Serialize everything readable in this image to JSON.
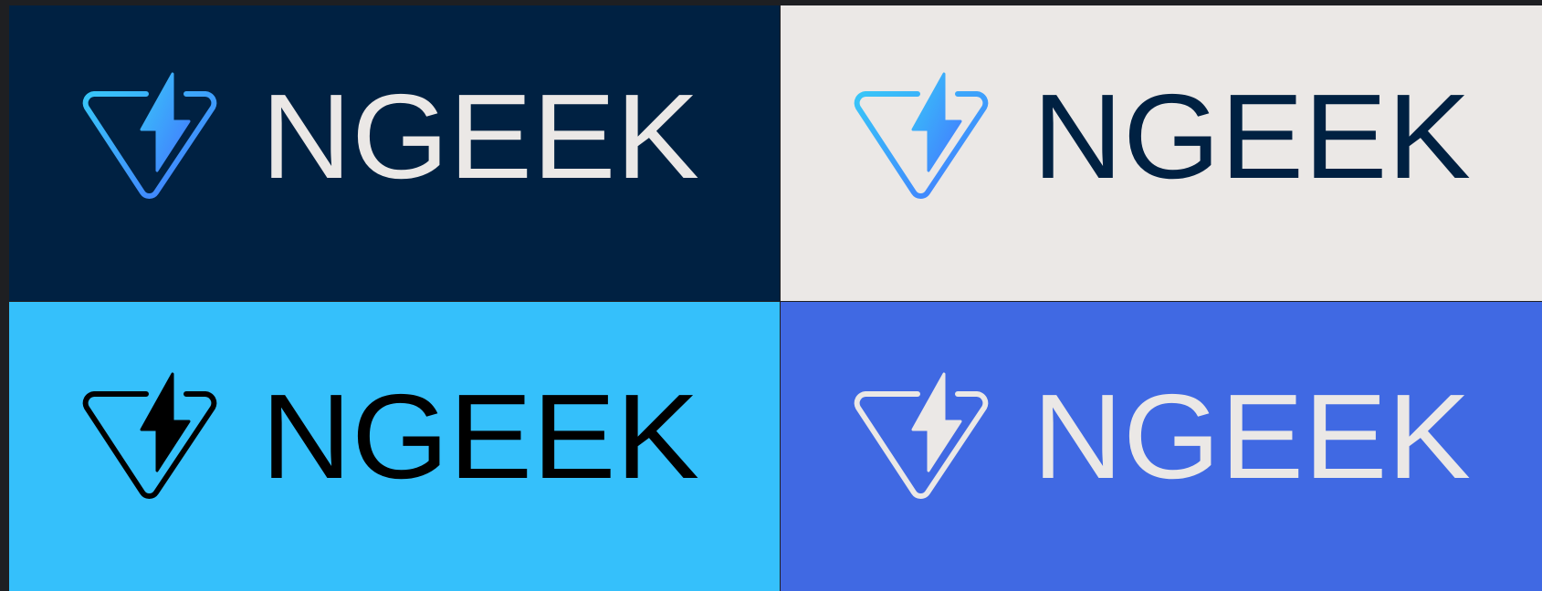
{
  "brand": {
    "wordmark": "NGEEK",
    "icon": "lightning-triangle-icon"
  },
  "colors": {
    "navy": "#002142",
    "light_gray": "#ebe8e6",
    "sky_blue": "#35c0fb",
    "royal_blue": "#4069e3",
    "gradient_start": "#38c6f8",
    "gradient_end": "#4377ff",
    "black": "#000000",
    "off_white": "#ebe8e6"
  },
  "panels": [
    {
      "variant": "gradient-on-navy",
      "wordmark": "NGEEK"
    },
    {
      "variant": "gradient-on-light-gray",
      "wordmark": "NGEEK"
    },
    {
      "variant": "black-on-sky-blue",
      "wordmark": "NGEEK"
    },
    {
      "variant": "white-on-royal-blue",
      "wordmark": "NGEEK"
    }
  ]
}
